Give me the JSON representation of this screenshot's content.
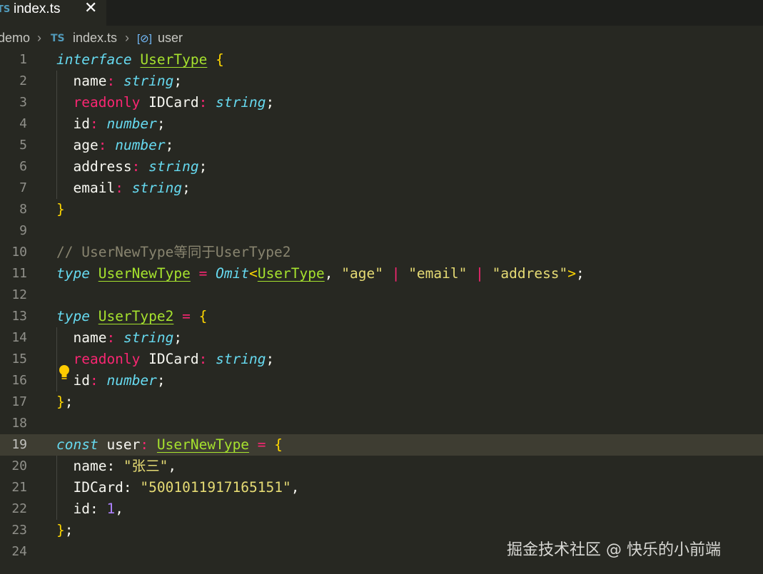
{
  "tab": {
    "lang_badge": "TS",
    "label": "index.ts",
    "close": "✕"
  },
  "breadcrumb": {
    "folder": "demo",
    "file_badge": "TS",
    "file": "index.ts",
    "symbol_icon": "[⊘]",
    "symbol": "user",
    "separator": "›"
  },
  "lines": [
    {
      "n": "1",
      "tokens": [
        [
          "k",
          "interface"
        ],
        [
          "w",
          " "
        ],
        [
          "t",
          "UserType"
        ],
        [
          "w",
          " "
        ],
        [
          "br",
          "{"
        ]
      ]
    },
    {
      "n": "2",
      "tokens": [
        [
          "w",
          "  name"
        ],
        [
          "p",
          ":"
        ],
        [
          "w",
          " "
        ],
        [
          "tn",
          "string"
        ],
        [
          "w",
          ";"
        ]
      ]
    },
    {
      "n": "3",
      "tokens": [
        [
          "w",
          "  "
        ],
        [
          "p",
          "readonly"
        ],
        [
          "w",
          " IDCard"
        ],
        [
          "p",
          ":"
        ],
        [
          "w",
          " "
        ],
        [
          "tn",
          "string"
        ],
        [
          "w",
          ";"
        ]
      ]
    },
    {
      "n": "4",
      "tokens": [
        [
          "w",
          "  id"
        ],
        [
          "p",
          ":"
        ],
        [
          "w",
          " "
        ],
        [
          "tn",
          "number"
        ],
        [
          "w",
          ";"
        ]
      ]
    },
    {
      "n": "5",
      "tokens": [
        [
          "w",
          "  age"
        ],
        [
          "p",
          ":"
        ],
        [
          "w",
          " "
        ],
        [
          "tn",
          "number"
        ],
        [
          "w",
          ";"
        ]
      ]
    },
    {
      "n": "6",
      "tokens": [
        [
          "w",
          "  address"
        ],
        [
          "p",
          ":"
        ],
        [
          "w",
          " "
        ],
        [
          "tn",
          "string"
        ],
        [
          "w",
          ";"
        ]
      ]
    },
    {
      "n": "7",
      "tokens": [
        [
          "w",
          "  email"
        ],
        [
          "p",
          ":"
        ],
        [
          "w",
          " "
        ],
        [
          "tn",
          "string"
        ],
        [
          "w",
          ";"
        ]
      ]
    },
    {
      "n": "8",
      "tokens": [
        [
          "br",
          "}"
        ]
      ]
    },
    {
      "n": "9",
      "tokens": []
    },
    {
      "n": "10",
      "tokens": [
        [
          "c",
          "// UserNewType等同于UserType2"
        ]
      ]
    },
    {
      "n": "11",
      "tokens": [
        [
          "k",
          "type"
        ],
        [
          "w",
          " "
        ],
        [
          "t",
          "UserNewType"
        ],
        [
          "w",
          " "
        ],
        [
          "p",
          "="
        ],
        [
          "w",
          " "
        ],
        [
          "fn",
          "Omit"
        ],
        [
          "br",
          "<"
        ],
        [
          "t",
          "UserType"
        ],
        [
          "w",
          ", "
        ],
        [
          "s",
          "\"age\""
        ],
        [
          "w",
          " "
        ],
        [
          "p",
          "|"
        ],
        [
          "w",
          " "
        ],
        [
          "s",
          "\"email\""
        ],
        [
          "w",
          " "
        ],
        [
          "p",
          "|"
        ],
        [
          "w",
          " "
        ],
        [
          "s",
          "\"address\""
        ],
        [
          "br",
          ">"
        ],
        [
          "w",
          ";"
        ]
      ]
    },
    {
      "n": "12",
      "tokens": []
    },
    {
      "n": "13",
      "tokens": [
        [
          "k",
          "type"
        ],
        [
          "w",
          " "
        ],
        [
          "t",
          "UserType2"
        ],
        [
          "w",
          " "
        ],
        [
          "p",
          "="
        ],
        [
          "w",
          " "
        ],
        [
          "br",
          "{"
        ]
      ]
    },
    {
      "n": "14",
      "tokens": [
        [
          "w",
          "  name"
        ],
        [
          "p",
          ":"
        ],
        [
          "w",
          " "
        ],
        [
          "tn",
          "string"
        ],
        [
          "w",
          ";"
        ]
      ]
    },
    {
      "n": "15",
      "tokens": [
        [
          "w",
          "  "
        ],
        [
          "p",
          "readonly"
        ],
        [
          "w",
          " IDCard"
        ],
        [
          "p",
          ":"
        ],
        [
          "w",
          " "
        ],
        [
          "tn",
          "string"
        ],
        [
          "w",
          ";"
        ]
      ]
    },
    {
      "n": "16",
      "tokens": [
        [
          "w",
          "  id"
        ],
        [
          "p",
          ":"
        ],
        [
          "w",
          " "
        ],
        [
          "tn",
          "number"
        ],
        [
          "w",
          ";"
        ]
      ]
    },
    {
      "n": "17",
      "tokens": [
        [
          "br",
          "}"
        ],
        [
          "w",
          ";"
        ]
      ]
    },
    {
      "n": "18",
      "tokens": []
    },
    {
      "n": "19",
      "tokens": [
        [
          "k",
          "const"
        ],
        [
          "w",
          " user"
        ],
        [
          "p",
          ":"
        ],
        [
          "w",
          " "
        ],
        [
          "t",
          "UserNewType"
        ],
        [
          "w",
          " "
        ],
        [
          "p",
          "="
        ],
        [
          "w",
          " "
        ],
        [
          "br",
          "{"
        ]
      ]
    },
    {
      "n": "20",
      "tokens": [
        [
          "w",
          "  name: "
        ],
        [
          "s",
          "\"张三\""
        ],
        [
          "w",
          ","
        ]
      ]
    },
    {
      "n": "21",
      "tokens": [
        [
          "w",
          "  IDCard: "
        ],
        [
          "s",
          "\"5001011917165151\""
        ],
        [
          "w",
          ","
        ]
      ]
    },
    {
      "n": "22",
      "tokens": [
        [
          "w",
          "  id: "
        ],
        [
          "n",
          "1"
        ],
        [
          "w",
          ","
        ]
      ]
    },
    {
      "n": "23",
      "tokens": [
        [
          "br",
          "}"
        ],
        [
          "w",
          ";"
        ]
      ]
    },
    {
      "n": "24",
      "tokens": []
    }
  ],
  "active_line": "19",
  "lightbulb_icon": "lightbulb-icon",
  "watermark": "掘金技术社区 @ 快乐的小前端"
}
